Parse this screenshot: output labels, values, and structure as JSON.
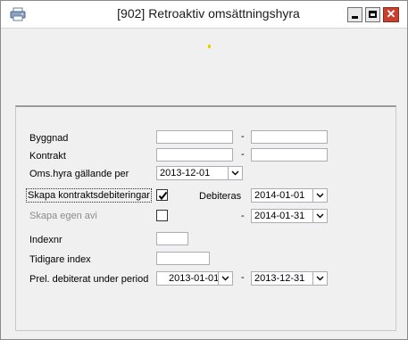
{
  "window": {
    "title": "[902]  Retroaktiv omsättningshyra",
    "icon": "printer-icon",
    "controls": {
      "minimize": "minimize-icon",
      "maximize": "maximize-icon",
      "close": "close-icon",
      "close_glyph": "✕"
    }
  },
  "form": {
    "byggnad": {
      "label": "Byggnad",
      "from": "",
      "to": "",
      "dash": "-"
    },
    "kontrakt": {
      "label": "Kontrakt",
      "from": "",
      "to": "",
      "dash": "-"
    },
    "oms_hyra": {
      "label": "Oms.hyra gällande per",
      "value": "2013-12-01"
    },
    "skapa_kontrakt": {
      "label": "Skapa kontraktsdebiteringar",
      "checked": true
    },
    "debiteras": {
      "label": "Debiteras",
      "from": "2014-01-01",
      "dash": "-",
      "to": "2014-01-31"
    },
    "skapa_avi": {
      "label": "Skapa egen avi",
      "checked": false
    },
    "indexnr": {
      "label": "Indexnr",
      "value": ""
    },
    "tidigare_index": {
      "label": "Tidigare index",
      "value": ""
    },
    "prel_debiterat": {
      "label": "Prel. debiterat under period",
      "from": "2013-01-01",
      "dash": "-",
      "to": "2013-12-31"
    }
  },
  "colors": {
    "close_button": "#c7412c",
    "accent_dot": "#e8d200"
  }
}
